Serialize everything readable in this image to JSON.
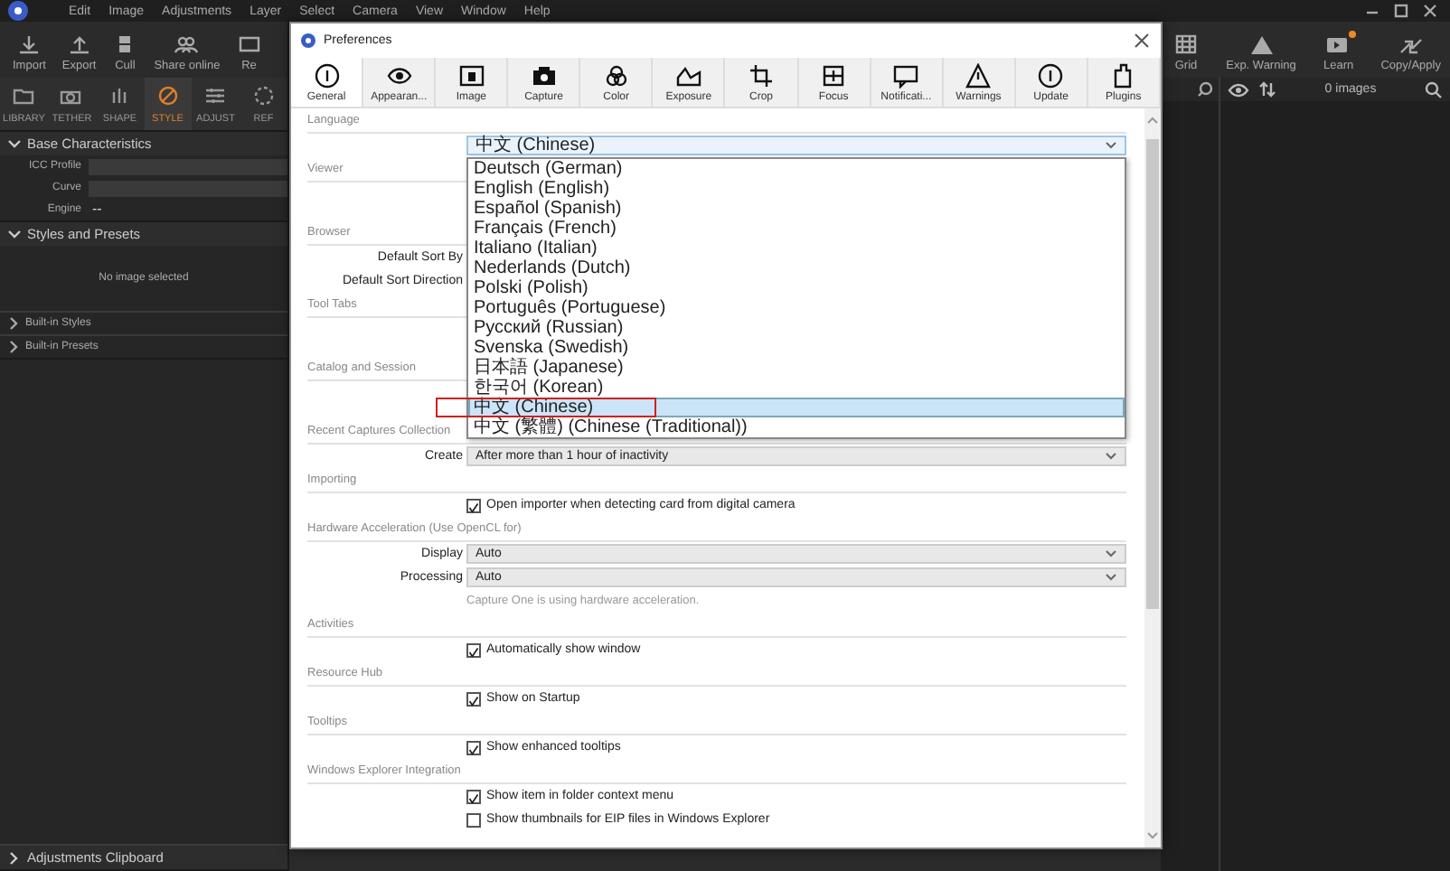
{
  "menu": [
    "Edit",
    "Image",
    "Adjustments",
    "Layer",
    "Select",
    "Camera",
    "View",
    "Window",
    "Help"
  ],
  "left_toolbar": [
    {
      "label": "Import"
    },
    {
      "label": "Export"
    },
    {
      "label": "Cull"
    },
    {
      "label": "Share online"
    },
    {
      "label": "Re"
    }
  ],
  "tool_tabs": [
    {
      "label": "LIBRARY",
      "selected": false
    },
    {
      "label": "TETHER",
      "selected": false
    },
    {
      "label": "SHAPE",
      "selected": false
    },
    {
      "label": "STYLE",
      "selected": true
    },
    {
      "label": "ADJUST",
      "selected": false
    },
    {
      "label": "REF",
      "selected": false
    }
  ],
  "left_panels": [
    {
      "title": "Base Characteristics",
      "expanded": true,
      "fields": [
        {
          "label": "ICC Profile"
        },
        {
          "label": "Curve"
        },
        {
          "label": "Engine",
          "value": "--"
        }
      ]
    },
    {
      "title": "Styles and Presets",
      "expanded": true,
      "empty_text": "No image selected",
      "groups": [
        "Built-in Styles",
        "Built-in Presets"
      ]
    },
    {
      "title": "Adjustments Clipboard",
      "expanded": false
    }
  ],
  "right_toolbar": [
    {
      "label": "Grid"
    },
    {
      "label": "Exp. Warning"
    },
    {
      "label": "Learn",
      "badge": true
    },
    {
      "label": "Copy/Apply"
    }
  ],
  "browser": {
    "count": "0 images"
  },
  "dialog": {
    "title": "Preferences",
    "tabs": [
      {
        "label": "General",
        "selected": true
      },
      {
        "label": "Appearan...",
        "selected": false
      },
      {
        "label": "Image",
        "selected": false
      },
      {
        "label": "Capture",
        "selected": false
      },
      {
        "label": "Color",
        "selected": false
      },
      {
        "label": "Exposure",
        "selected": false
      },
      {
        "label": "Crop",
        "selected": false
      },
      {
        "label": "Focus",
        "selected": false
      },
      {
        "label": "Notificati...",
        "selected": false
      },
      {
        "label": "Warnings",
        "selected": false
      },
      {
        "label": "Update",
        "selected": false
      },
      {
        "label": "Plugins",
        "selected": false
      }
    ],
    "sections": [
      {
        "title": "Language",
        "rows": [
          {
            "kind": "select",
            "value": "中文 (Chinese)",
            "open": true,
            "options": [
              {
                "label": "Deutsch (German)",
                "selected": false
              },
              {
                "label": "English (English)",
                "selected": false
              },
              {
                "label": "Español (Spanish)",
                "selected": false
              },
              {
                "label": "Français (French)",
                "selected": false
              },
              {
                "label": "Italiano (Italian)",
                "selected": false
              },
              {
                "label": "Nederlands (Dutch)",
                "selected": false
              },
              {
                "label": "Polski (Polish)",
                "selected": false
              },
              {
                "label": "Português (Portuguese)",
                "selected": false
              },
              {
                "label": "Русский (Russian)",
                "selected": false
              },
              {
                "label": "Svenska (Swedish)",
                "selected": false
              },
              {
                "label": "日本語 (Japanese)",
                "selected": false
              },
              {
                "label": "한국어 (Korean)",
                "selected": false
              },
              {
                "label": "中文 (Chinese)",
                "selected": true
              },
              {
                "label": "中文 (繁體) (Chinese (Traditional))",
                "selected": false
              }
            ]
          }
        ]
      },
      {
        "title": "Viewer"
      },
      {
        "title": "Browser",
        "rows": [
          {
            "kind": "label",
            "label": "Default Sort By"
          },
          {
            "kind": "label",
            "label": "Default Sort Direction"
          }
        ]
      },
      {
        "title": "Tool Tabs"
      },
      {
        "title": "Catalog and Session"
      },
      {
        "title": "Recent Captures Collection",
        "rows": [
          {
            "kind": "select",
            "label": "Create",
            "value": "After more than 1 hour of inactivity",
            "open": false
          }
        ]
      },
      {
        "title": "Importing",
        "rows": [
          {
            "kind": "checkbox",
            "label": "Open importer when detecting card from digital camera",
            "checked": true
          }
        ]
      },
      {
        "title": "Hardware Acceleration (Use OpenCL for)",
        "rows": [
          {
            "kind": "select",
            "label": "Display",
            "value": "Auto",
            "open": false
          },
          {
            "kind": "select",
            "label": "Processing",
            "value": "Auto",
            "open": false
          },
          {
            "kind": "note",
            "label": "Capture One is using hardware acceleration."
          }
        ]
      },
      {
        "title": "Activities",
        "rows": [
          {
            "kind": "checkbox",
            "label": "Automatically show window",
            "checked": true
          }
        ]
      },
      {
        "title": "Resource Hub",
        "rows": [
          {
            "kind": "checkbox",
            "label": "Show on Startup",
            "checked": true
          }
        ]
      },
      {
        "title": "Tooltips",
        "rows": [
          {
            "kind": "checkbox",
            "label": "Show enhanced tooltips",
            "checked": true
          }
        ]
      },
      {
        "title": "Windows Explorer Integration",
        "rows": [
          {
            "kind": "checkbox",
            "label": "Show item in folder context menu",
            "checked": true
          },
          {
            "kind": "checkbox",
            "label": "Show thumbnails for EIP files in Windows Explorer",
            "checked": false
          }
        ]
      }
    ]
  }
}
